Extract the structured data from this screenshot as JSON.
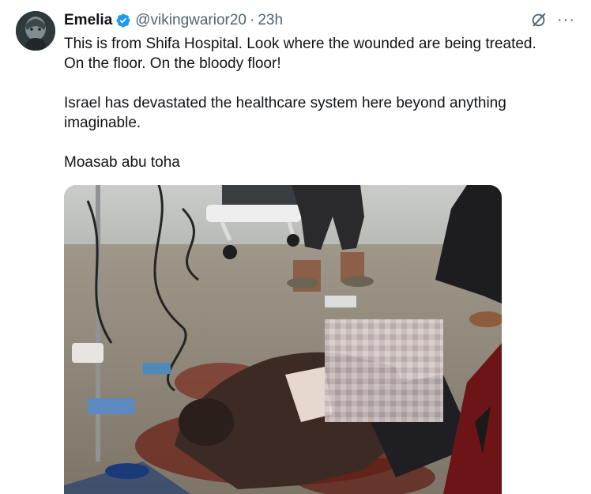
{
  "author": {
    "display_name": "Emelia",
    "handle": "@vikingwarior20",
    "separator": "·",
    "timestamp": "23h",
    "verified": true,
    "avatar_icon": "avatar-image"
  },
  "actions": {
    "grok_icon": "grok-icon",
    "more_label": "···"
  },
  "text": {
    "line1": "This is from Shifa Hospital. Look where the wounded are being treated.",
    "line2": "On the floor. On the bloody floor!",
    "line3": "Israel has devastated the healthcare system here beyond anything",
    "line4": "imaginable.",
    "line5": "Moasab abu toha"
  },
  "media": {
    "type": "photo",
    "blurred_region": true
  },
  "colors": {
    "text": "#0f1419",
    "secondary": "#536471",
    "verified": "#1d9bf0"
  }
}
